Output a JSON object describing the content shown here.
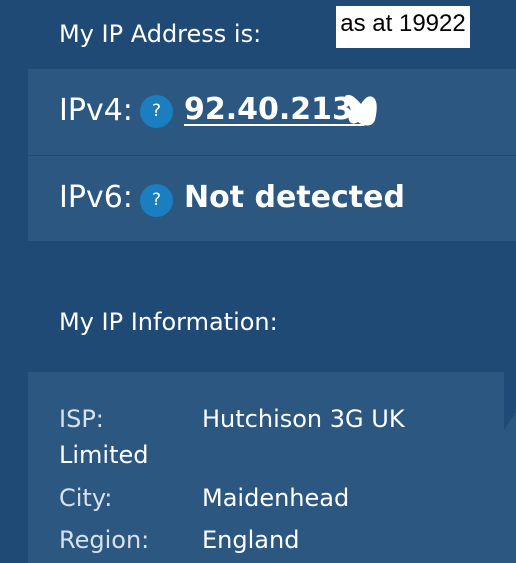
{
  "header": {
    "address_heading": "My IP Address is:",
    "stamp": "as at 19922"
  },
  "ipv4": {
    "label": "IPv4:",
    "help_icon": "?",
    "value": "92.40.213."
  },
  "ipv6": {
    "label": "IPv6:",
    "help_icon": "?",
    "value": "Not detected"
  },
  "info": {
    "heading": "My IP Information:",
    "isp_label": "ISP:",
    "isp_value": "Hutchison 3G UK",
    "isp_value_continued": "Limited",
    "city_label": "City:",
    "city_value": "Maidenhead",
    "region_label": "Region:",
    "region_value": "England"
  },
  "colors": {
    "background": "#1f4a76",
    "panel": "#2b5781",
    "help_icon": "#1b7ec1",
    "text": "#ffffff"
  }
}
